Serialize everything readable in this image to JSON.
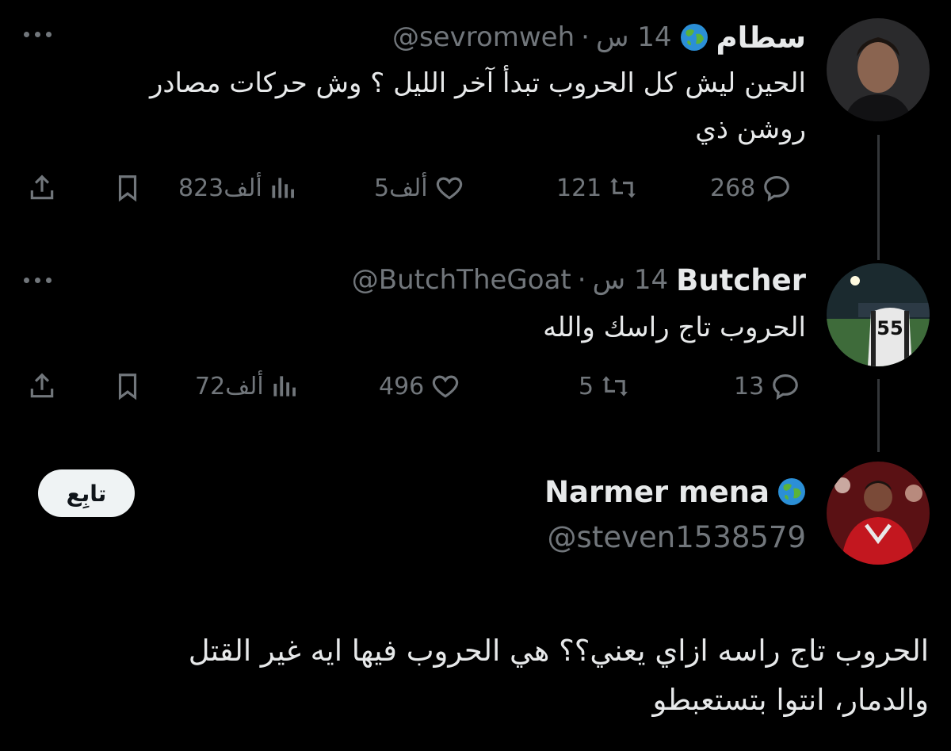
{
  "tweets": [
    {
      "name": "سطام",
      "handle": "@sevromweh",
      "time": "14 س",
      "text_line1": "الحين ليش كل الحروب تبدأ آخر الليل ؟ وش حركات مصادر",
      "text_line2": "روشن ذي",
      "replies": "268",
      "retweets": "121",
      "likes": "5ألف",
      "views": "823ألف"
    },
    {
      "name": "Butcher",
      "handle": "@ButchTheGoat",
      "time": "14 س",
      "text_line1": "الحروب تاج راسك والله",
      "replies": "13",
      "retweets": "5",
      "likes": "496",
      "views": "72ألف"
    }
  ],
  "main_tweet": {
    "name": "Narmer mena",
    "handle": "@steven1538579",
    "follow_label": "تابِع",
    "text_line1": "الحروب تاج راسه ازاي يعني؟؟ هي الحروب فيها ايه غير القتل",
    "text_line2": "والدمار، انتوا بتستعبطو"
  },
  "avatar2_jersey": "55",
  "icons": [
    "more-icon",
    "globe-icon",
    "reply-icon",
    "retweet-icon",
    "like-icon",
    "views-icon",
    "bookmark-icon",
    "share-icon"
  ],
  "colors": {
    "background": "#000000",
    "text": "#e7e9ea",
    "muted": "#71767b",
    "button_bg": "#eff3f4"
  }
}
